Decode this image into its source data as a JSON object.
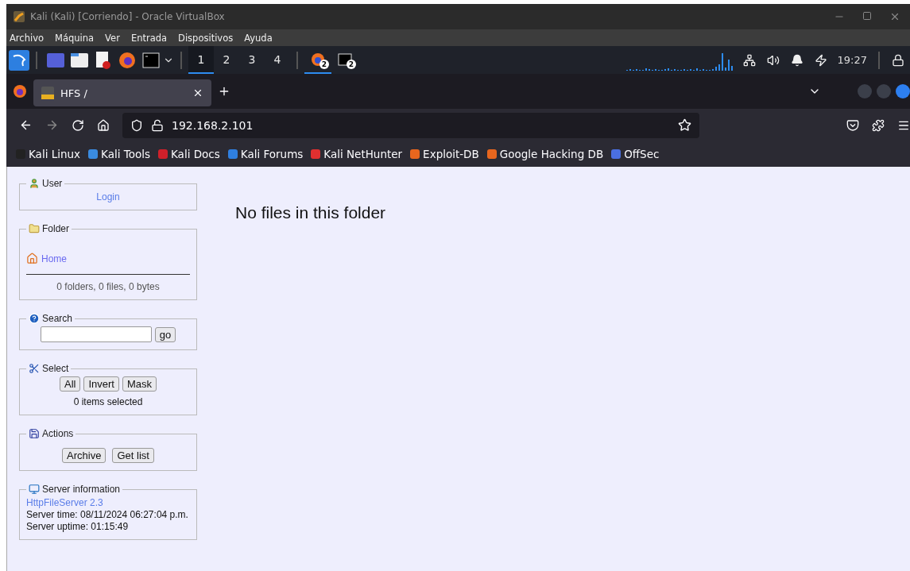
{
  "window": {
    "title": "Kali (Kali) [Corriendo] - Oracle VirtualBox"
  },
  "menu": [
    "Archivo",
    "Máquina",
    "Ver",
    "Entrada",
    "Dispositivos",
    "Ayuda"
  ],
  "panel": {
    "workspaces": [
      {
        "label": "1",
        "selected": true
      },
      {
        "label": "2",
        "selected": false
      },
      {
        "label": "3",
        "selected": false
      },
      {
        "label": "4",
        "selected": false
      }
    ],
    "tasks": [
      {
        "kind": "browser",
        "badge": "2",
        "selected": true
      },
      {
        "kind": "terminal",
        "badge": "2",
        "selected": false
      }
    ],
    "clock": "19:27"
  },
  "browser": {
    "tabs": [
      {
        "title": "HFS /",
        "selected": true
      }
    ],
    "url": "192.168.2.101",
    "bookmarks": [
      {
        "label": "Kali Linux",
        "color": "#222222"
      },
      {
        "label": "Kali Tools",
        "color": "#3a8be0"
      },
      {
        "label": "Kali Docs",
        "color": "#d0202a"
      },
      {
        "label": "Kali Forums",
        "color": "#2f7fe0"
      },
      {
        "label": "Kali NetHunter",
        "color": "#e03030"
      },
      {
        "label": "Exploit-DB",
        "color": "#e8661e"
      },
      {
        "label": "Google Hacking DB",
        "color": "#e8661e"
      },
      {
        "label": "OffSec",
        "color": "#4a6fe0"
      }
    ]
  },
  "hfs": {
    "user": {
      "legend": "User",
      "login": "Login"
    },
    "folder": {
      "legend": "Folder",
      "home": "Home",
      "summary": "0 folders, 0 files, 0 bytes"
    },
    "search": {
      "legend": "Search",
      "button": "go"
    },
    "select": {
      "legend": "Select",
      "buttons": [
        "All",
        "Invert",
        "Mask"
      ],
      "summary": "0 items selected"
    },
    "actions": {
      "legend": "Actions",
      "buttons": [
        "Archive",
        "Get list"
      ]
    },
    "server": {
      "legend": "Server information",
      "link": "HttpFileServer 2.3",
      "lines": [
        "Server time: 08/11/2024 06:27:04 p.m.",
        "Server uptime: 01:15:49"
      ]
    },
    "message": "No files in this folder"
  }
}
